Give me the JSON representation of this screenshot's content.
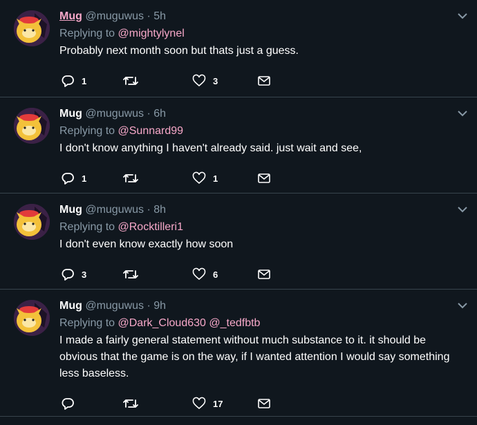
{
  "colors": {
    "background": "#10171e",
    "divider": "#38444d",
    "mention": "#f7a8c9",
    "secondary_text": "#8899a6"
  },
  "icons": [
    "avatar-isabelle",
    "chevron-down-icon",
    "reply-icon",
    "retweet-icon",
    "heart-icon",
    "message-icon"
  ],
  "tweets": [
    {
      "name": "Mug",
      "handle": "@muguwus",
      "separator": "·",
      "time": "5h",
      "replying_prefix": "Replying to",
      "replying_to": "@mightylynel",
      "text": "Probably next month soon but thats just a guess.",
      "replies": "1",
      "retweets": "",
      "likes": "3"
    },
    {
      "name": "Mug",
      "handle": "@muguwus",
      "separator": "·",
      "time": "6h",
      "replying_prefix": "Replying to",
      "replying_to": "@Sunnard99",
      "text": "I don't know anything I haven't already said. just wait and see,",
      "replies": "1",
      "retweets": "",
      "likes": "1"
    },
    {
      "name": "Mug",
      "handle": "@muguwus",
      "separator": "·",
      "time": "8h",
      "replying_prefix": "Replying to",
      "replying_to": "@Rocktilleri1",
      "text": "I don't even know exactly how soon",
      "replies": "3",
      "retweets": "",
      "likes": "6"
    },
    {
      "name": "Mug",
      "handle": "@muguwus",
      "separator": "·",
      "time": "9h",
      "replying_prefix": "Replying to",
      "replying_to": "@Dark_Cloud630 @_tedfbtb",
      "text": "I made a fairly general statement without much substance to it. it should be obvious that the game is on the way, if I wanted attention I would say something less baseless.",
      "replies": "",
      "retweets": "",
      "likes": "17"
    }
  ]
}
